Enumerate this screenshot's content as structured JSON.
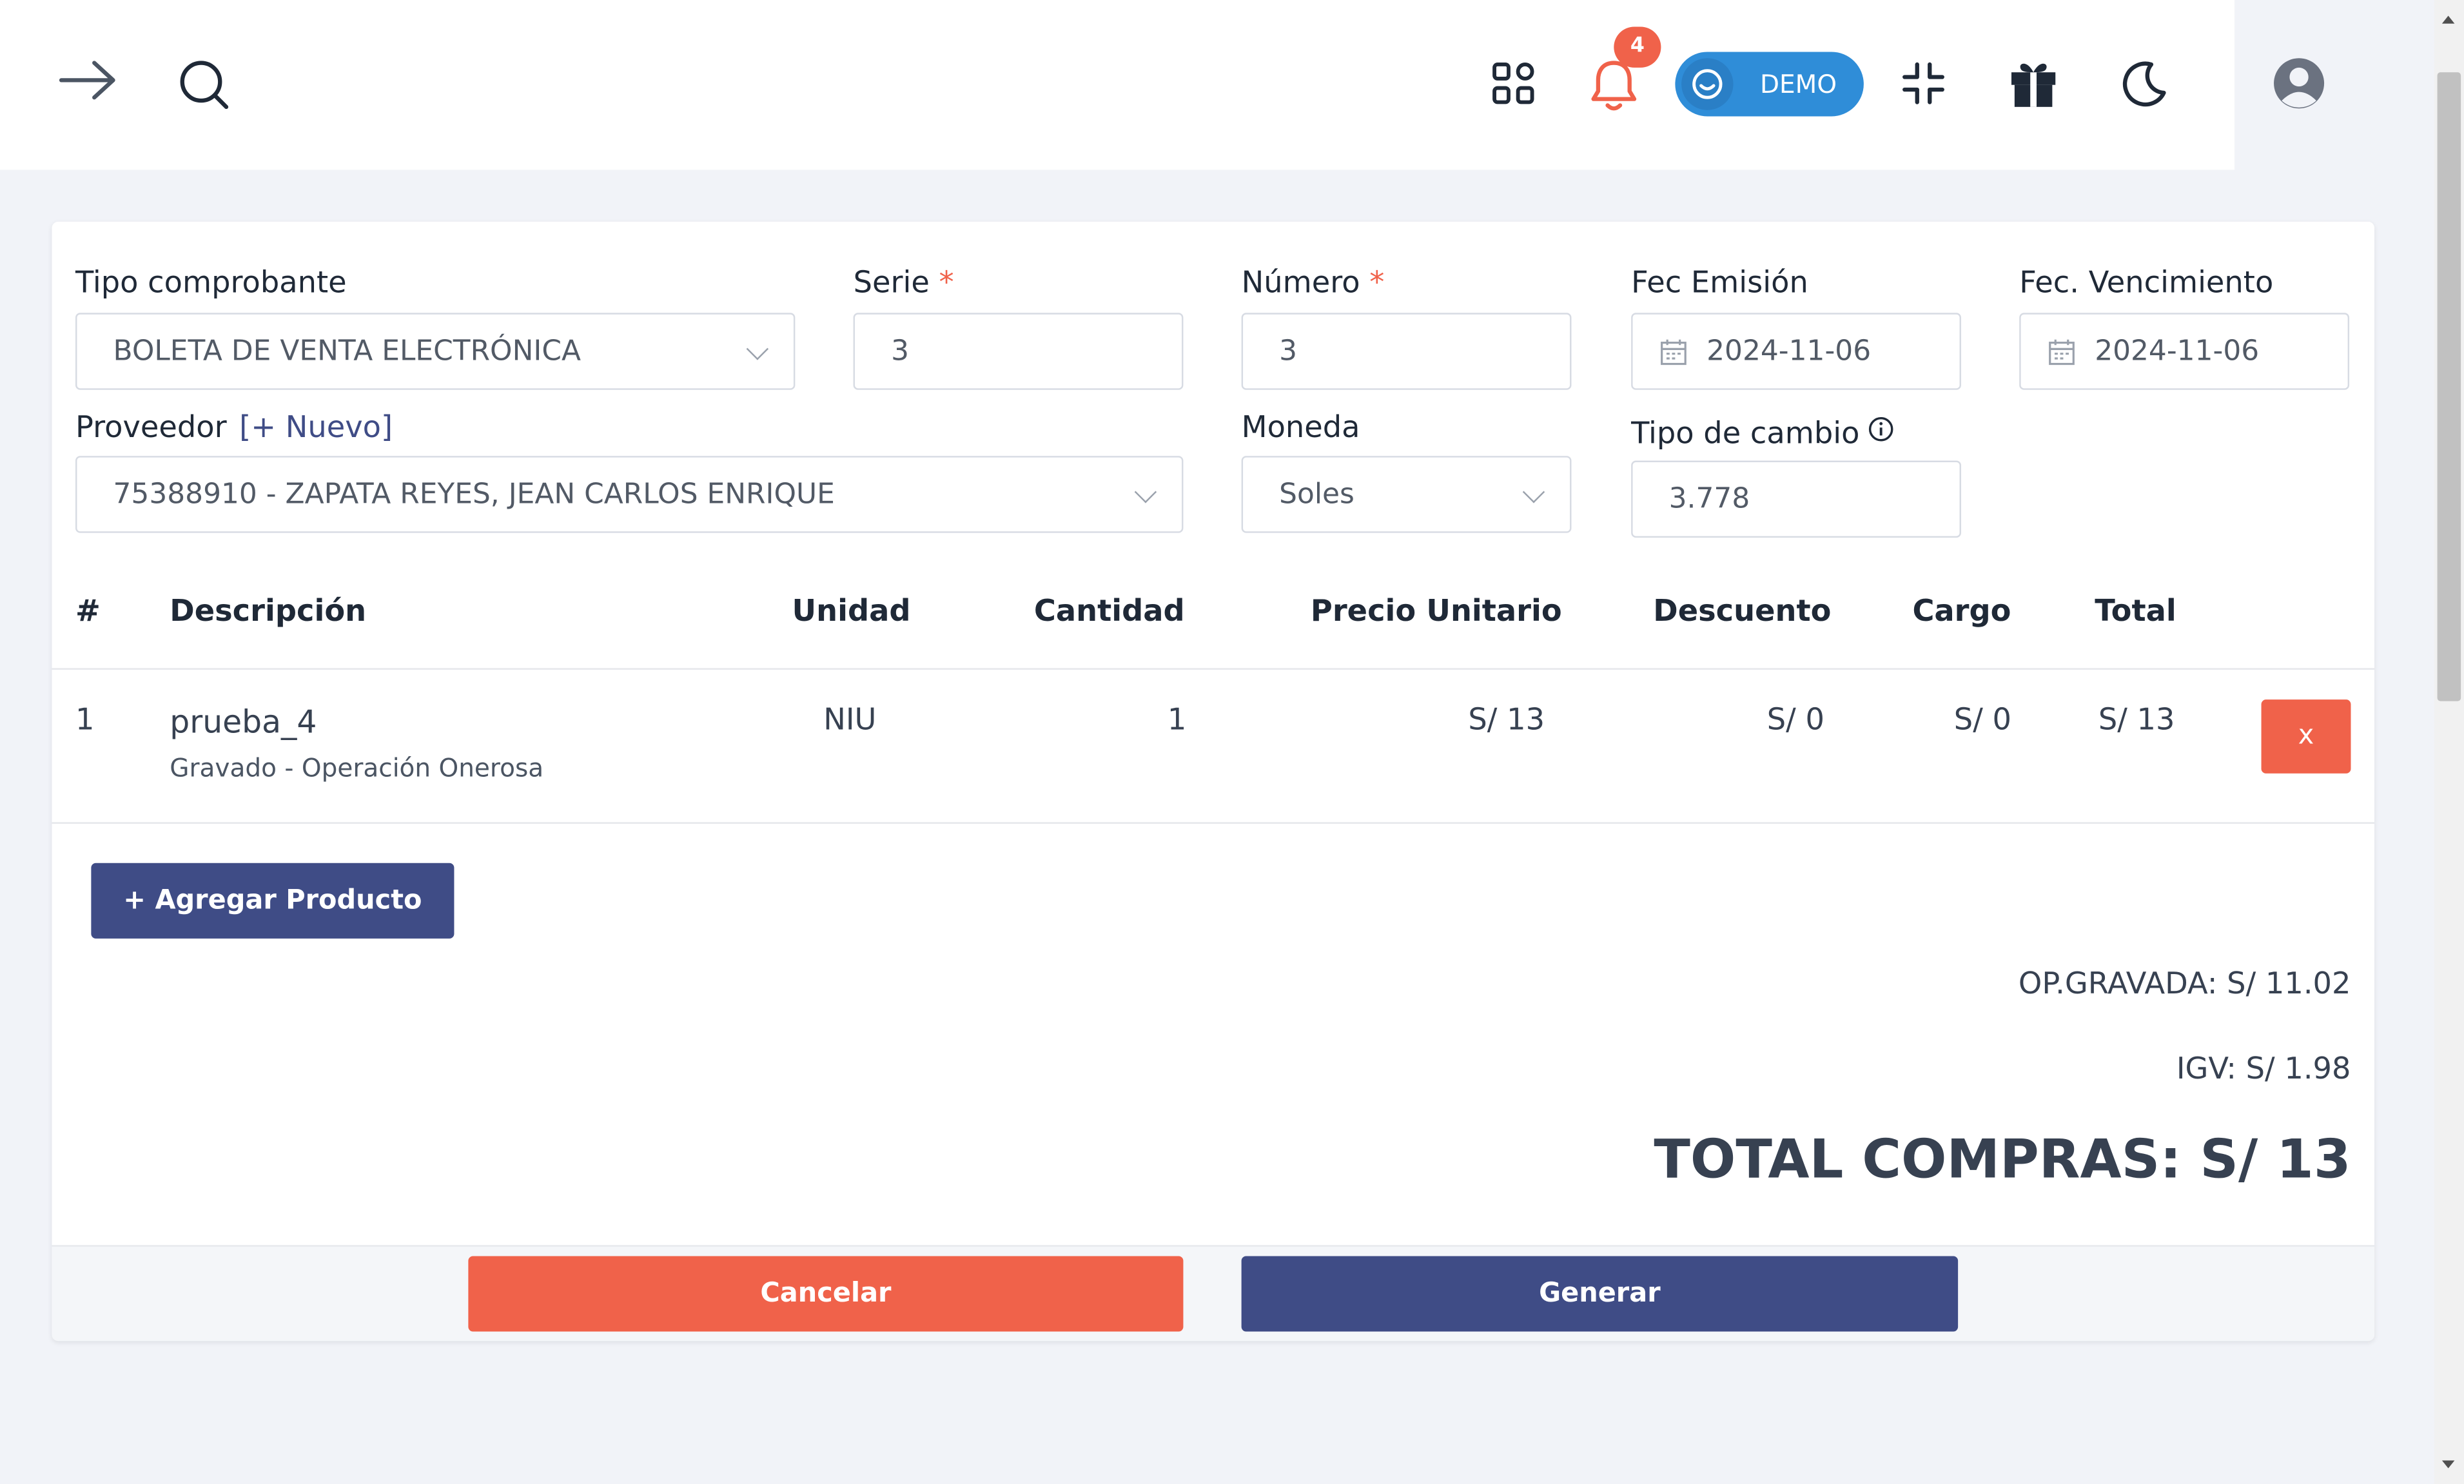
{
  "topbar": {
    "notification_count": "4",
    "demo_label": "DEMO",
    "icons": [
      "arrow-right-icon",
      "search-icon",
      "apps-grid-icon",
      "bell-icon",
      "compress-icon",
      "gift-icon",
      "moon-icon",
      "user-circle-icon"
    ]
  },
  "form": {
    "tipo_label": "Tipo comprobante",
    "tipo_value": "BOLETA DE VENTA ELECTRÓNICA",
    "serie_label": "Serie",
    "serie_value": "3",
    "numero_label": "Número",
    "numero_value": "3",
    "required_mark": "*",
    "fec_emision_label": "Fec Emisión",
    "fec_emision_value": "2024-11-06",
    "fec_venc_label": "Fec. Vencimiento",
    "fec_venc_value": "2024-11-06",
    "proveedor_label": "Proveedor",
    "nuevo_link": "[+ Nuevo]",
    "proveedor_value": "75388910 - ZAPATA REYES, JEAN CARLOS ENRIQUE",
    "moneda_label": "Moneda",
    "moneda_value": "Soles",
    "tipo_cambio_label": "Tipo de cambio",
    "tipo_cambio_value": "3.778"
  },
  "table": {
    "headers": {
      "num": "#",
      "descripcion": "Descripción",
      "unidad": "Unidad",
      "cantidad": "Cantidad",
      "precio": "Precio Unitario",
      "descuento": "Descuento",
      "cargo": "Cargo",
      "total": "Total"
    },
    "rows": [
      {
        "num": "1",
        "descripcion": "prueba_4",
        "detalle": "Gravado - Operación Onerosa",
        "unidad": "NIU",
        "cantidad": "1",
        "precio": "S/ 13",
        "descuento": "S/ 0",
        "cargo": "S/ 0",
        "total": "S/ 13",
        "delete_label": "x"
      }
    ]
  },
  "actions": {
    "add_product": "+ Agregar Producto",
    "cancel": "Cancelar",
    "generate": "Generar"
  },
  "totals": {
    "op_gravada": "OP.GRAVADA: S/ 11.02",
    "igv": "IGV: S/ 1.98",
    "total_compras": "TOTAL COMPRAS: S/ 13"
  },
  "colors": {
    "primary": "#3f4c86",
    "danger": "#f0624a",
    "demo": "#2f8dd8"
  }
}
